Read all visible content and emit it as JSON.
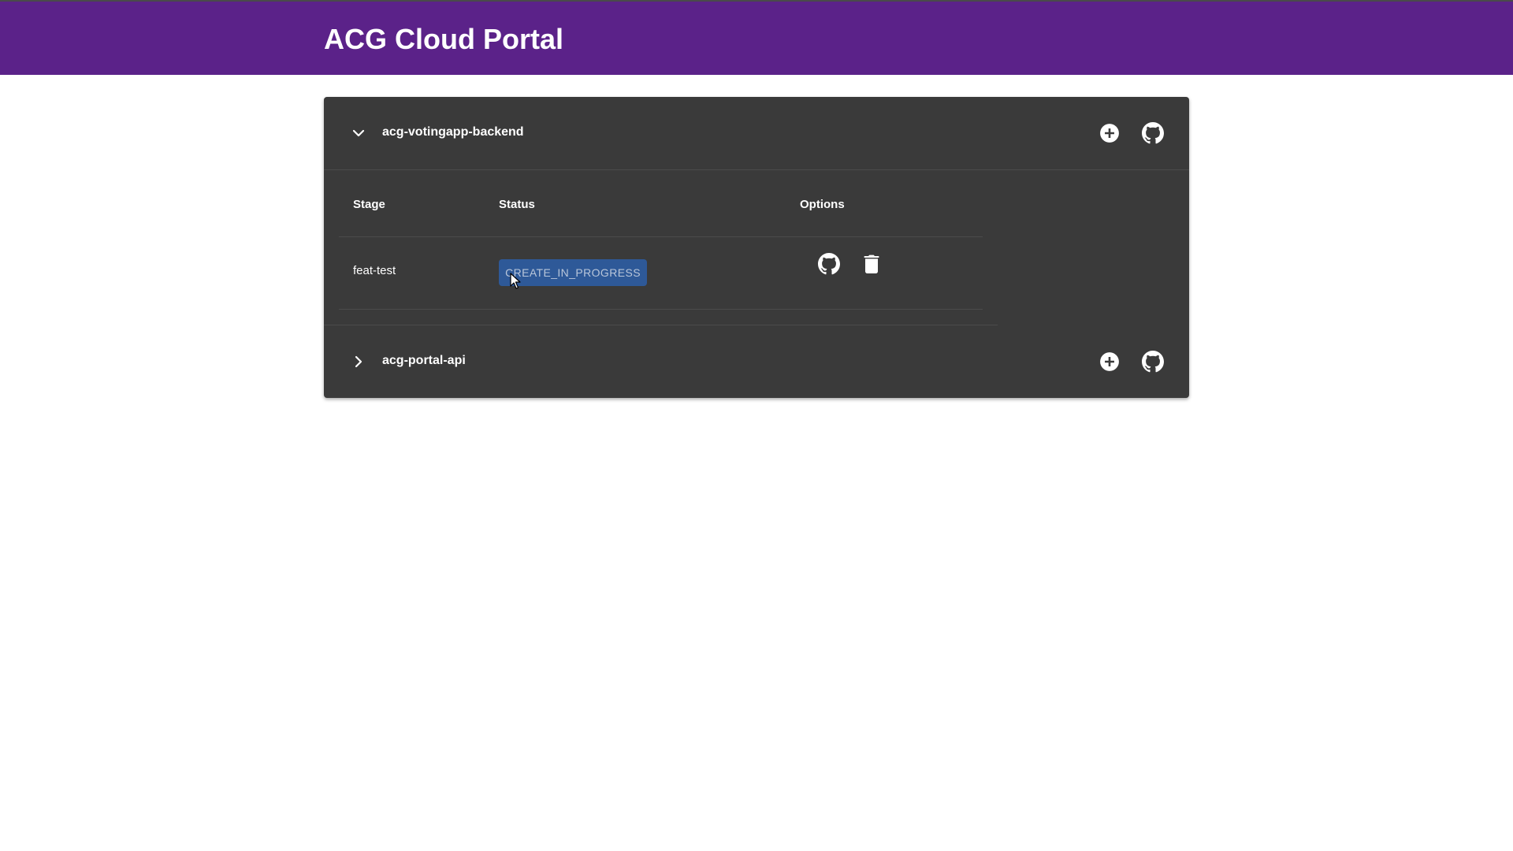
{
  "app": {
    "title": "ACG Cloud Portal"
  },
  "colors": {
    "appbar": "#5b2289",
    "panel": "#3a3a3a",
    "status_badge": "#2e5998"
  },
  "repositories": [
    {
      "name": "acg-votingapp-backend",
      "expanded": true,
      "chevron_icon": "chevron-down-icon",
      "actions": [
        "add-icon",
        "github-icon"
      ],
      "table": {
        "headers": {
          "stage": "Stage",
          "status": "Status",
          "options": "Options"
        },
        "rows": [
          {
            "stage": "feat-test",
            "status": "CREATE_IN_PROGRESS",
            "options": [
              "github-icon",
              "trash-icon"
            ]
          }
        ]
      }
    },
    {
      "name": "acg-portal-api",
      "expanded": false,
      "chevron_icon": "chevron-right-icon",
      "actions": [
        "add-icon",
        "github-icon"
      ]
    }
  ]
}
